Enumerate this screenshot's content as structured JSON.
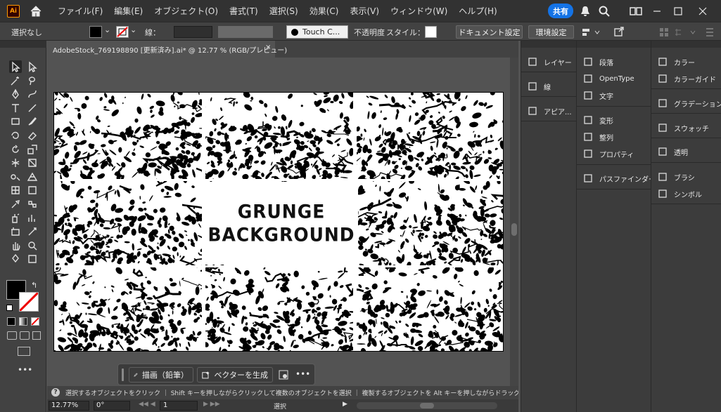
{
  "app": {
    "logo": "Ai"
  },
  "menu": [
    "ファイル(F)",
    "編集(E)",
    "オブジェクト(O)",
    "書式(T)",
    "選択(S)",
    "効果(C)",
    "表示(V)",
    "ウィンドウ(W)",
    "ヘルプ(H)"
  ],
  "share": "共有",
  "control": {
    "selection": "選択なし",
    "stroke_label": "線：",
    "brush": "Touch C...",
    "opacity": "不透明度",
    "style": "スタイル：",
    "doc_setup": "ドキュメント設定",
    "prefs": "環境設定"
  },
  "doc": {
    "tab_title": "AdobeStock_769198890 [更新済み].ai* @ 12.77 % (RGB/プレビュー)",
    "tab_close": "×"
  },
  "artwork": {
    "line1": "GRUNGE",
    "line2": "BACKGROUND"
  },
  "taskbar": {
    "draw": "描画（鉛筆）",
    "vectorize": "ベクターを生成",
    "more": "•••"
  },
  "status_text": "選択するオブジェクトをクリック ｜ Shift キーを押しながらクリックして複数のオブジェクトを選択 ｜ 複製するオブジェクトを Alt キーを押しながらドラッグ",
  "bottom": {
    "zoom": "12.77%",
    "angle": "0°",
    "artboard": "1",
    "tool": "選択"
  },
  "panels": {
    "col1": [
      "レイヤー",
      "線",
      "アピア..."
    ],
    "col2": [
      "段落",
      "OpenType",
      "文字",
      "変形",
      "整列",
      "プロパティ",
      "パスファインダー"
    ],
    "col3": [
      "カラー",
      "カラーガイド",
      "グラデーション",
      "スウォッチ",
      "透明",
      "ブラシ",
      "シンボル"
    ]
  },
  "colors": {
    "accent": "#1473e6",
    "bg": "#535353",
    "panel": "#3c3c3c"
  },
  "icons": [
    "home-icon",
    "notification-icon",
    "search-icon",
    "workspace-icon",
    "selection-tool-icon",
    "pen-tool-icon",
    "type-tool-icon",
    "hand-tool-icon",
    "zoom-tool-icon"
  ]
}
